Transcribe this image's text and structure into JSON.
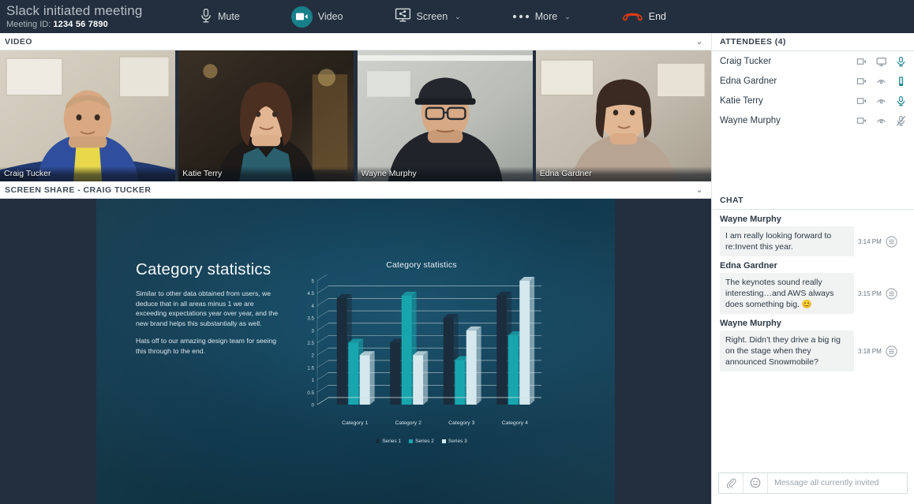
{
  "header": {
    "title": "Slack initiated meeting",
    "meeting_id_label": "Meeting ID:",
    "meeting_id": "1234 56 7890",
    "buttons": [
      {
        "label": "Mute",
        "icon": "microphone-icon",
        "caret": ""
      },
      {
        "label": "Video",
        "icon": "video-camera-icon",
        "caret": ""
      },
      {
        "label": "Screen",
        "icon": "screen-share-icon",
        "caret": "⌄"
      },
      {
        "label": "More",
        "icon": "ellipsis-icon",
        "caret": "⌄"
      },
      {
        "label": "End",
        "icon": "end-call-icon",
        "caret": ""
      }
    ],
    "colors": {
      "bar": "#232f3e",
      "accent": "#17808a",
      "end": "#d6411e"
    }
  },
  "video_section": {
    "label": "VIDEO",
    "collapse_icon": "chevron-down-icon",
    "tiles": [
      {
        "name": "Craig Tucker"
      },
      {
        "name": "Katie Terry"
      },
      {
        "name": "Wayne Murphy"
      },
      {
        "name": "Edna Gardner"
      }
    ]
  },
  "share_section": {
    "label": "SCREEN SHARE - CRAIG TUCKER",
    "collapse_icon": "chevron-down-icon"
  },
  "slide": {
    "title": "Category statistics",
    "paragraphs": [
      "Similar to other data obtained from users, we deduce that in all areas minus 1 we are exceeding expectations year over year, and the new brand helps this substantially as well.",
      "Hats off to our amazing design team for seeing this through to the end."
    ]
  },
  "chart_data": {
    "type": "bar",
    "title": "Category statistics",
    "xlabel": "",
    "ylabel": "",
    "ylim": [
      0,
      5
    ],
    "yticks": [
      "0",
      "0.5",
      "1",
      "1.5",
      "2",
      "2.5",
      "3",
      "3.5",
      "4",
      "4.5",
      "5"
    ],
    "grid": true,
    "legend_position": "bottom",
    "categories": [
      "Category 1",
      "Category 2",
      "Category 3",
      "Category 4"
    ],
    "series": [
      {
        "name": "Series 1",
        "color": "#1b2c3c",
        "values": [
          4.3,
          2.5,
          3.5,
          4.4
        ]
      },
      {
        "name": "Series 2",
        "color": "#18a6ae",
        "values": [
          2.5,
          4.4,
          1.8,
          2.8
        ]
      },
      {
        "name": "Series 3",
        "color": "#d5e8ed",
        "values": [
          2.0,
          2.0,
          3.0,
          5.0
        ]
      }
    ]
  },
  "attendees": {
    "label": "ATTENDEES (4)",
    "count": 4,
    "rows": [
      {
        "name": "Craig Tucker",
        "icons": [
          "camera-icon",
          "monitor-icon",
          "microphone-icon"
        ],
        "mic_state": "on",
        "mic_color": "#17808a"
      },
      {
        "name": "Edna Gardner",
        "icons": [
          "camera-icon",
          "dial-in-icon",
          "phone-handset-icon"
        ],
        "mic_state": "phone",
        "mic_color": "#17808a"
      },
      {
        "name": "Katie Terry",
        "icons": [
          "camera-icon",
          "dial-in-icon",
          "microphone-icon"
        ],
        "mic_state": "on",
        "mic_color": "#17808a"
      },
      {
        "name": "Wayne Murphy",
        "icons": [
          "camera-icon",
          "dial-in-icon",
          "microphone-muted-icon"
        ],
        "mic_state": "muted",
        "mic_color": "#8d979f"
      }
    ]
  },
  "chat": {
    "label": "CHAT",
    "messages": [
      {
        "author": "Wayne Murphy",
        "text": "I am really looking forward to re:Invent this year.",
        "time": "3:14 PM",
        "menu_icon": "message-menu-icon"
      },
      {
        "author": "Edna Gardner",
        "text": "The keynotes sound really interesting…and AWS always does something big.      😊",
        "time": "3:15 PM",
        "menu_icon": "message-menu-icon"
      },
      {
        "author": "Wayne Murphy",
        "text": "Right. Didn’t they drive a big rig on the stage when they announced Snowmobile?",
        "time": "3:18 PM",
        "menu_icon": "message-menu-icon"
      }
    ],
    "composer": {
      "attach_icon": "paperclip-icon",
      "emoji_icon": "emoji-icon",
      "placeholder": "Message all currently invited",
      "value": ""
    }
  }
}
